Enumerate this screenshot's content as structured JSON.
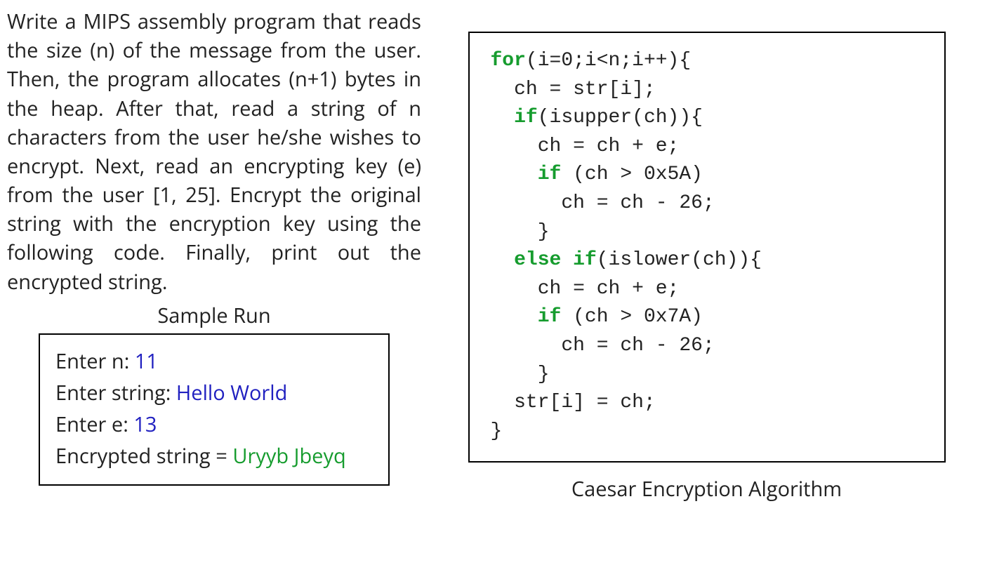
{
  "instructions": "Write a MIPS assembly program that reads the size (n) of the message from the user.  Then, the program allocates (n+1) bytes in the heap.  After that, read a string of n characters from the user he/she wishes to encrypt.  Next, read an encrypting key (e) from the user [1, 25].  Encrypt the original string with the encryption key using the following code.  Finally, print out the encrypted string.",
  "sample_run": {
    "title": "Sample Run",
    "lines": {
      "n_prompt": "Enter n: ",
      "n_value": "11",
      "string_prompt": "Enter string: ",
      "string_value": "Hello World",
      "e_prompt": "Enter e: ",
      "e_value": "13",
      "result_prompt": "Encrypted string = ",
      "result_value": "Uryyb Jbeyq"
    }
  },
  "code": {
    "kw_for": "for",
    "for_rest": "(i=0;i<n;i++){",
    "l2": "  ch = str[i];",
    "kw_if1": "if",
    "if1_rest": "(isupper(ch)){",
    "l4": "    ch = ch + e;",
    "kw_if2": "if",
    "if2_rest": " (ch > 0x5A)",
    "l6": "      ch = ch - 26;",
    "l7": "    }",
    "kw_else": "else",
    "kw_if3": "if",
    "if3_rest": "(islower(ch)){",
    "l9": "    ch = ch + e;",
    "kw_if4": "if",
    "if4_rest": " (ch > 0x7A)",
    "l11": "      ch = ch - 26;",
    "l12": "    }",
    "l13": "  str[i] = ch;",
    "l14": "}"
  },
  "caption": "Caesar Encryption Algorithm"
}
